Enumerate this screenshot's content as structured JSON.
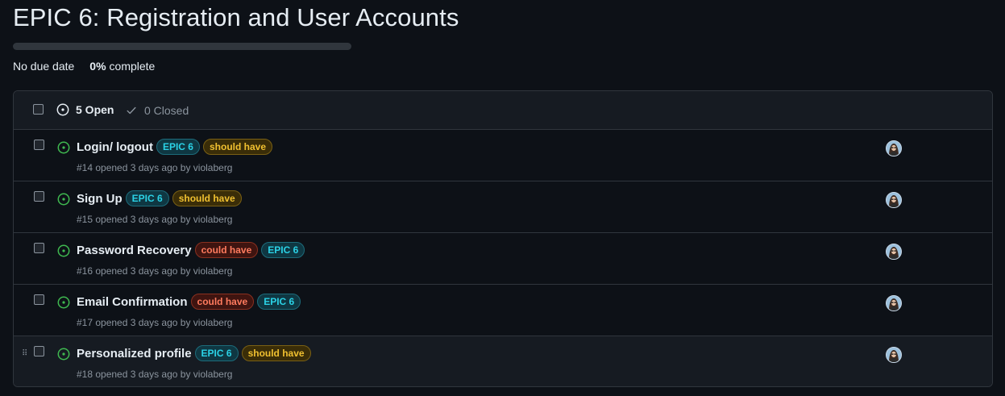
{
  "milestone": {
    "title": "EPIC 6: Registration and User Accounts",
    "progress_fraction": 0.0,
    "due_text": "No due date",
    "percent_text": "0%",
    "complete_label": "complete"
  },
  "tabs": {
    "open_label": "5 Open",
    "closed_label": "0 Closed"
  },
  "colors": {
    "open_icon": "#3fb950",
    "progress_fill": "#238636"
  },
  "icons": {
    "open": "issue-opened-icon",
    "closed": "check-icon",
    "drag": "drag-handle-icon",
    "avatar": "user-avatar"
  },
  "issues": [
    {
      "title": "Login/ logout",
      "labels": [
        {
          "text": "EPIC 6",
          "kind": "epic"
        },
        {
          "text": "should have",
          "kind": "should"
        }
      ],
      "meta": "#14 opened 3 days ago by violaberg"
    },
    {
      "title": "Sign Up",
      "labels": [
        {
          "text": "EPIC 6",
          "kind": "epic"
        },
        {
          "text": "should have",
          "kind": "should"
        }
      ],
      "meta": "#15 opened 3 days ago by violaberg"
    },
    {
      "title": "Password Recovery",
      "labels": [
        {
          "text": "could have",
          "kind": "could"
        },
        {
          "text": "EPIC 6",
          "kind": "epic"
        }
      ],
      "meta": "#16 opened 3 days ago by violaberg"
    },
    {
      "title": "Email Confirmation",
      "labels": [
        {
          "text": "could have",
          "kind": "could"
        },
        {
          "text": "EPIC 6",
          "kind": "epic"
        }
      ],
      "meta": "#17 opened 3 days ago by violaberg"
    },
    {
      "title": "Personalized profile",
      "labels": [
        {
          "text": "EPIC 6",
          "kind": "epic"
        },
        {
          "text": "should have",
          "kind": "should"
        }
      ],
      "meta": "#18 opened 3 days ago by violaberg"
    }
  ]
}
